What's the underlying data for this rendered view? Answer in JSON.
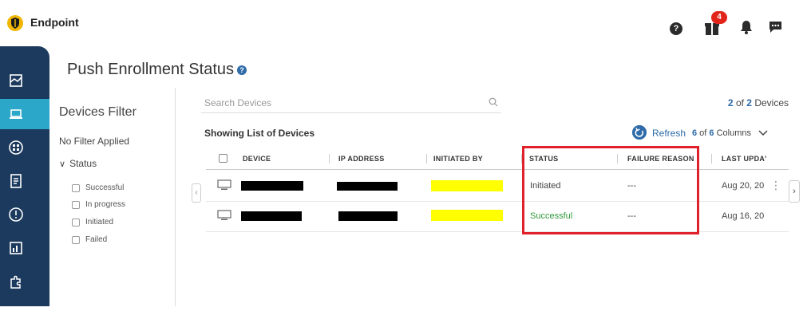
{
  "app": {
    "title": "Endpoint",
    "gift_badge": "4"
  },
  "header_icons": [
    "help-icon",
    "gift-icon",
    "bell-icon",
    "chat-icon"
  ],
  "page": {
    "title": "Push Enrollment Status",
    "info": "?"
  },
  "filter": {
    "title": "Devices Filter",
    "none_label": "No Filter Applied",
    "status_label": "Status",
    "options": [
      "Successful",
      "In progress",
      "Initiated",
      "Failed"
    ]
  },
  "search": {
    "placeholder": "Search Devices"
  },
  "count": {
    "shown": "2",
    "rest": " of ",
    "total": "2",
    "unit": " Devices"
  },
  "list": {
    "showing": "Showing List of Devices",
    "refresh": "Refresh",
    "columns_shown": "6",
    "columns_of": " of ",
    "columns_total": "6",
    "columns_unit": " Columns"
  },
  "table": {
    "headers": [
      "DEVICE",
      "IP ADDRESS",
      "INITIATED BY",
      "STATUS",
      "FAILURE REASON",
      "LAST UPDA’"
    ],
    "rows": [
      {
        "status": "Initiated",
        "failure": "---",
        "last_updated": "Aug 20, 20"
      },
      {
        "status": "Successful",
        "failure": "---",
        "last_updated": "Aug 16, 20"
      }
    ]
  },
  "colors": {
    "sidebar": "#1c3a5e",
    "accent": "#2aa7c9",
    "link": "#2e6ba8",
    "success": "#2e9a3a",
    "highlight": "#e0202a"
  }
}
